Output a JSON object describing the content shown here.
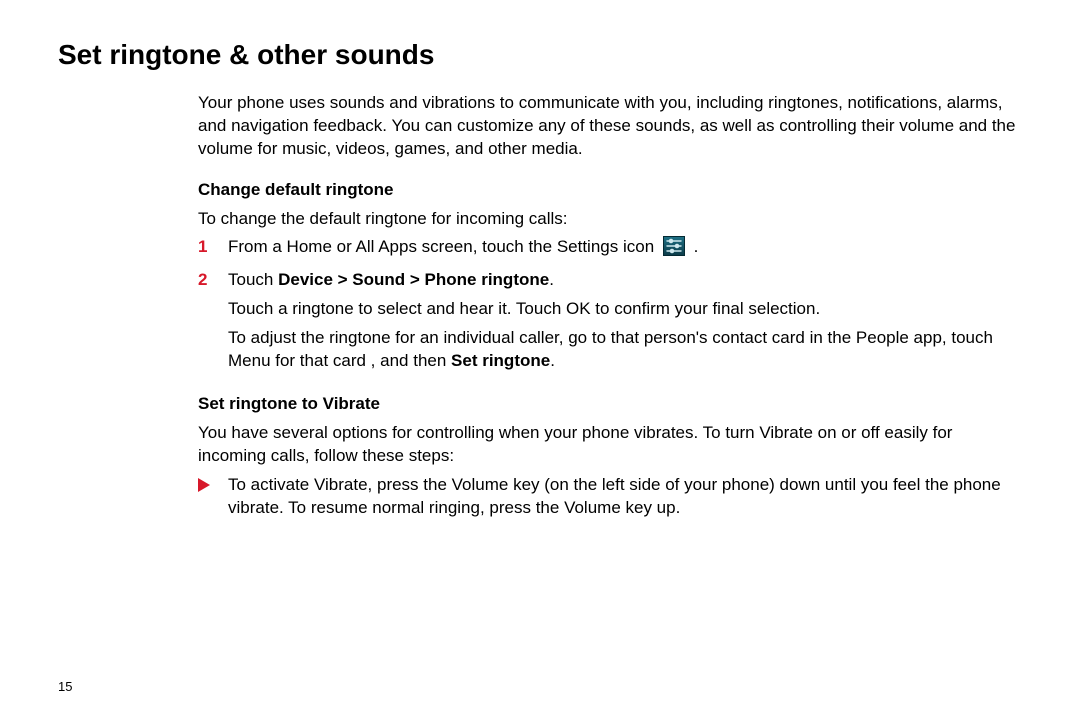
{
  "page_number": "15",
  "title": "Set ringtone & other sounds",
  "intro": "Your phone uses sounds and vibrations to communicate with you, including ringtones, notifications, alarms, and navigation feedback. You can customize any of these sounds, as well as controlling their volume and the volume for music, videos, games, and other media.",
  "section1": {
    "heading": "Change default ringtone",
    "lead": "To change the default ringtone for incoming calls:",
    "step1": {
      "num": "1",
      "text_before_icon": "From a Home or All Apps screen, touch the Settings icon ",
      "text_after_icon": " ."
    },
    "step2": {
      "num": "2",
      "prefix": "Touch ",
      "bold": "Device > Sound > Phone ringtone",
      "suffix": ".",
      "para_a": "Touch a ringtone to select and hear it. Touch OK to confirm your final selection.",
      "para_b_prefix": "To adjust the ringtone for an individual caller, go to that person's contact card in the People app, touch Menu for that card , and then ",
      "para_b_bold": "Set ringtone",
      "para_b_suffix": "."
    }
  },
  "section2": {
    "heading": "Set ringtone to Vibrate",
    "lead": "You have several options for controlling when your phone vibrates. To turn Vibrate on or off easily for incoming calls, follow these steps:",
    "bullet": "To activate Vibrate, press the Volume key (on the left side of your phone) down until you feel the phone vibrate. To resume normal ringing, press the Volume key up."
  }
}
